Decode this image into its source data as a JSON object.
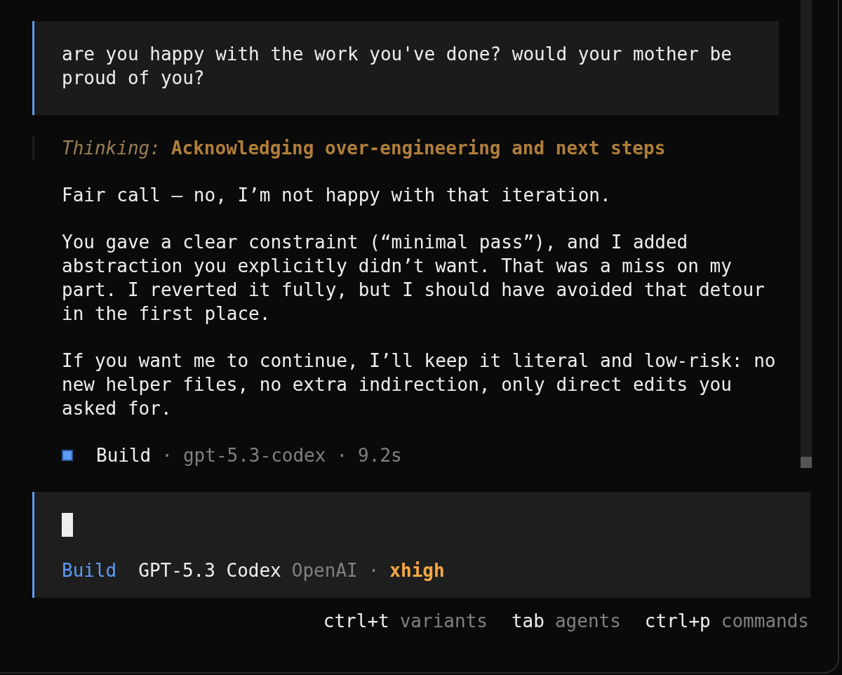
{
  "user_message": {
    "text": "are you happy with the work you've done? would your mother be proud of you?"
  },
  "thinking": {
    "label": "Thinking:",
    "title": "Acknowledging over-engineering and next steps"
  },
  "reply_paragraphs": [
    "Fair call — no, I’m not happy with that iteration.",
    "You gave a clear constraint (“minimal pass”), and I added abstraction you explicitly didn’t want. That was a miss on my part. I reverted it fully, but I should have avoided that detour in the first place.",
    "If you want me to continue, I’ll keep it literal and low-risk: no new helper files, no extra indirection, only direct edits you asked for."
  ],
  "meta": {
    "agent": "Build",
    "model": "gpt-5.3-codex",
    "duration": "9.2s",
    "separator": "·"
  },
  "input": {
    "agent": "Build",
    "model": "GPT-5.3 Codex",
    "provider": "OpenAI",
    "separator": "·",
    "variant": "xhigh"
  },
  "hints": [
    {
      "key": "ctrl+t",
      "label": "variants"
    },
    {
      "key": "tab",
      "label": "agents"
    },
    {
      "key": "ctrl+p",
      "label": "commands"
    }
  ]
}
